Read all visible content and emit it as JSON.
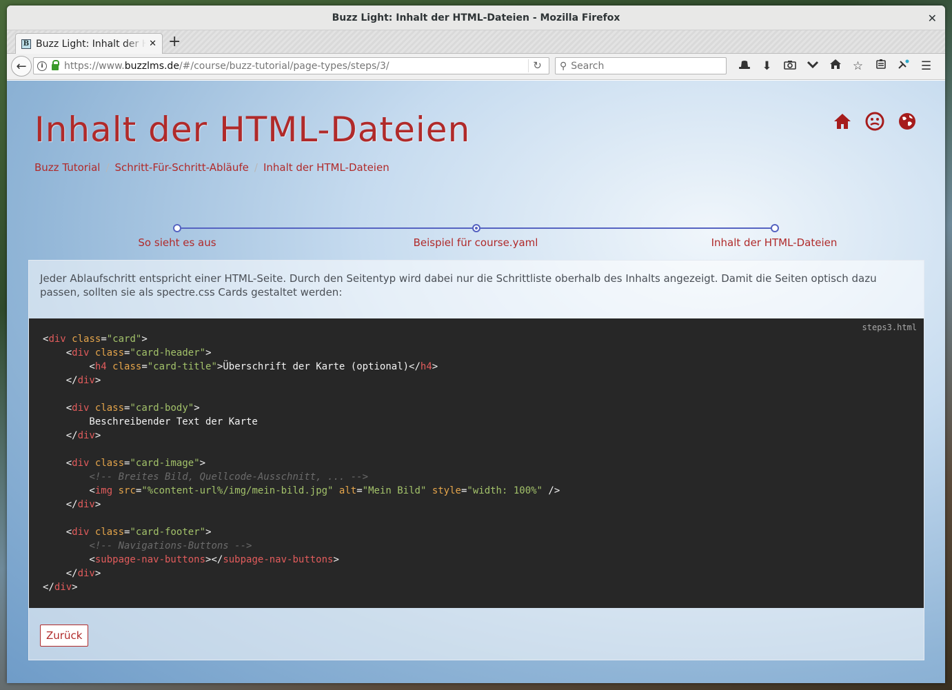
{
  "window": {
    "title": "Buzz Light: Inhalt der HTML-Dateien - Mozilla Firefox"
  },
  "tabs": [
    {
      "label": "Buzz Light: Inhalt der HTML-Dateien",
      "favicon": "B"
    }
  ],
  "navbar": {
    "url_prefix": "https://www.",
    "url_domain": "buzzlms.de",
    "url_rest": "/#/course/buzz-tutorial/page-types/steps/3/",
    "search_placeholder": "Search",
    "icons": [
      "hat-icon",
      "download-icon",
      "screenshot-icon",
      "pocket-icon",
      "home-icon",
      "bookmark-star-icon",
      "reading-list-icon",
      "extension-icon",
      "menu-icon"
    ]
  },
  "page": {
    "title": "Inhalt der HTML-Dateien",
    "header_icons": [
      "home-icon",
      "user-icon",
      "globe-icon"
    ],
    "accent_color": "#b02a2a",
    "breadcrumb": [
      "Buzz Tutorial",
      "Schritt-Für-Schritt-Abläufe",
      "Inhalt der HTML-Dateien"
    ],
    "steps": [
      {
        "label": "So sieht es aus",
        "active": false
      },
      {
        "label": "Beispiel für course.yaml",
        "active": true
      },
      {
        "label": "Inhalt der HTML-Dateien",
        "active": false
      }
    ],
    "description": "Jeder Ablaufschritt entspricht einer HTML-Seite. Durch den Seitentyp wird dabei nur die Schrittliste oberhalb des Inhalts angezeigt. Damit die Seiten optisch dazu passen, sollten sie als spectre.css Cards gestaltet werden:",
    "code_filename": "steps3.html",
    "back_button": "Zurück"
  }
}
